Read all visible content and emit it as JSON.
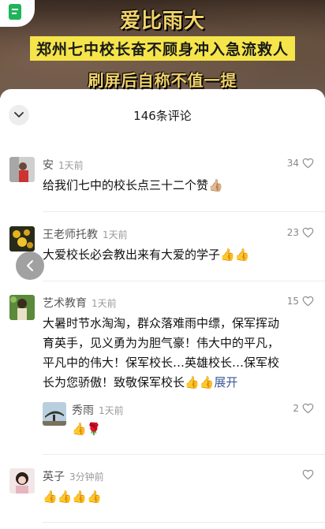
{
  "video": {
    "title": "爱比雨大",
    "subtitle": "郑州七中校长奋不顾身冲入急流救人",
    "footer": "刷屏后自称不值一提"
  },
  "sheet": {
    "title": "146条评论"
  },
  "comments": [
    {
      "name": "安",
      "time": "1天前",
      "likes": "34",
      "text": "给我们七中的校长点三十二个赞👍🏼"
    },
    {
      "name": "王老师托教",
      "time": "1天前",
      "likes": "23",
      "text": "大爱校长必会教出来有大爱的学子👍👍"
    },
    {
      "name": "艺术教育",
      "time": "1天前",
      "likes": "15",
      "text": "大暑时节水淘淘，群众落难雨中缥，保军挥动育英手，见义勇为为胆气豪！伟大中的平凡，平凡中的伟大！保军校长…英雄校长…保军校长为您骄傲！致敬保军校长👍👍",
      "expand": "展开",
      "reply": {
        "name": "秀雨",
        "time": "1天前",
        "likes": "2",
        "text": "👍🌹"
      }
    },
    {
      "name": "英子",
      "time": "3分钟前",
      "likes": "",
      "text": "👍👍👍👍"
    }
  ],
  "icons": {
    "collapse": "chevron-down-icon",
    "like": "heart-icon",
    "back": "chevron-left-icon",
    "app": "document-icon"
  },
  "colors": {
    "link": "#3d5a96",
    "banner_text": "#f2d36b",
    "banner_highlight": "#f5e54a"
  }
}
